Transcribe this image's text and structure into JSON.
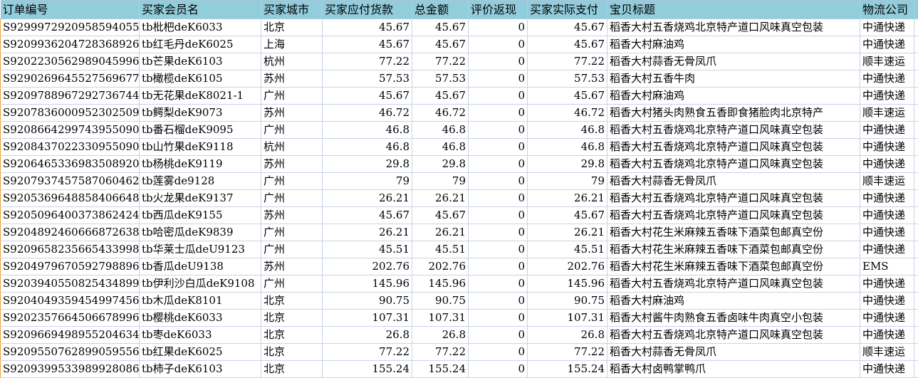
{
  "headers": [
    "订单编号",
    "买家会员名",
    "买家城市",
    "买家应付货款",
    "总金额",
    "评价返现",
    "买家实际支付",
    "宝贝标题",
    "物流公司"
  ],
  "rows": [
    [
      "S9299972920958594055",
      "tb枇杷deK6033",
      "北京",
      "45.67",
      "45.67",
      "0",
      "45.67",
      "稻香大村五香烧鸡北京特产道口风味真空包装",
      "中通快递"
    ],
    [
      "S9209936204728368926",
      "tb红毛丹deK6025",
      "上海",
      "45.67",
      "45.67",
      "0",
      "45.67",
      "稻香大村麻油鸡",
      "中通快递"
    ],
    [
      "S9202230562989045996",
      "tb芒果deK6103",
      "杭州",
      "77.22",
      "77.22",
      "0",
      "77.22",
      "稻香大村蒜香无骨凤爪",
      "顺丰速运"
    ],
    [
      "S9290269645527569677",
      "tb橄榄deK6105",
      "苏州",
      "57.53",
      "57.53",
      "0",
      "57.53",
      "稻香大村五香牛肉",
      "中通快递"
    ],
    [
      "S9209788967292736744",
      "tb无花果deK8021-1",
      "广州",
      "45.67",
      "45.67",
      "0",
      "45.67",
      "稻香大村麻油鸡",
      "中通快递"
    ],
    [
      "S9207836000952302509",
      "tb鳄梨deK9073",
      "苏州",
      "46.72",
      "46.72",
      "0",
      "46.72",
      "稻香大村猪头肉熟食五香即食猪脸肉北京特产",
      "顺丰速运"
    ],
    [
      "S9208664299743955090",
      "tb番石榴deK9095",
      "广州",
      "46.8",
      "46.8",
      "0",
      "46.8",
      "稻香大村五香烧鸡北京特产道口风味真空包装",
      "中通快递"
    ],
    [
      "S9208437022330955090",
      "tb山竹果deK9118",
      "杭州",
      "46.8",
      "46.8",
      "0",
      "46.8",
      "稻香大村五香烧鸡北京特产道口风味真空包装",
      "中通快递"
    ],
    [
      "S9206465336983508920",
      "tb杨桃deK9119",
      "苏州",
      "29.8",
      "29.8",
      "0",
      "29.8",
      "稻香大村五香烧鸡北京特产道口风味真空包装",
      "中通快递"
    ],
    [
      "S9207937457587060462",
      "tb莲雾de9128",
      "广州",
      "79",
      "79",
      "0",
      "79",
      "稻香大村蒜香无骨凤爪",
      "顺丰速运"
    ],
    [
      "S9205369648858406648",
      "tb火龙果deK9137",
      "广州",
      "26.21",
      "26.21",
      "0",
      "26.21",
      "稻香大村五香烧鸡北京特产道口风味真空包装",
      "中通快递"
    ],
    [
      "S9205096400373862424",
      "tb西瓜deK9155",
      "苏州",
      "45.67",
      "45.67",
      "0",
      "45.67",
      "稻香大村五香烧鸡北京特产道口风味真空包装",
      "中通快递"
    ],
    [
      "S9204892460666872638",
      "tb哈密瓜deK9839",
      "广州",
      "26.21",
      "26.21",
      "0",
      "26.21",
      "稻香大村花生米麻辣五香味下酒菜包邮真空份",
      "中通快递"
    ],
    [
      "S9209658235665433998",
      "tb华莱士瓜deU9123",
      "广州",
      "45.51",
      "45.51",
      "0",
      "45.51",
      "稻香大村花生米麻辣五香味下酒菜包邮真空份",
      "中通快递"
    ],
    [
      "S9204979670592798896",
      "tb香瓜deU9138",
      "苏州",
      "202.76",
      "202.76",
      "0",
      "202.76",
      "稻香大村花生米麻辣五香味下酒菜包邮真空份",
      "EMS"
    ],
    [
      "S9203940550825434899",
      "tb伊利沙白瓜deK9108",
      "广州",
      "145.96",
      "145.96",
      "0",
      "145.96",
      "稻香大村五香烧鸡北京特产道口风味真空包装",
      "中通快递"
    ],
    [
      "S9204049359454997456",
      "tb木瓜deK8101",
      "北京",
      "90.75",
      "90.75",
      "0",
      "90.75",
      "稻香大村麻油鸡",
      "中通快递"
    ],
    [
      "S9202357664506678996",
      "tb樱桃deK6033",
      "北京",
      "107.31",
      "107.31",
      "0",
      "107.31",
      "稻香大村酱牛肉熟食五香卤味牛肉真空小包装",
      "中通快递"
    ],
    [
      "S9209669498955204634",
      "tb枣deK6033",
      "北京",
      "26.8",
      "26.8",
      "0",
      "26.8",
      "稻香大村五香烧鸡北京特产道口风味真空包装",
      "中通快递"
    ],
    [
      "S9209550762899059556",
      "tb红果deK6025",
      "北京",
      "77.22",
      "77.22",
      "0",
      "77.22",
      "稻香大村蒜香无骨凤爪",
      "顺丰速运"
    ],
    [
      "S9209399533989928086",
      "tb柿子deK6103",
      "北京",
      "155.24",
      "155.24",
      "0",
      "155.24",
      "稻香大村卤鸭掌鸭爪",
      "中通快递"
    ]
  ]
}
